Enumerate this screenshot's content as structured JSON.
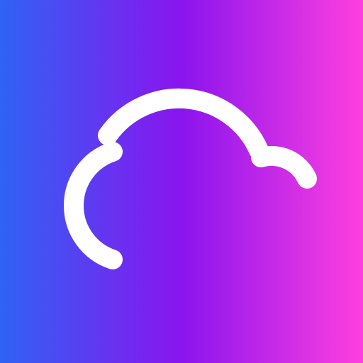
{
  "icon": {
    "name": "cloud-icon",
    "colors": {
      "gradient_start": "#2F63F4",
      "gradient_mid": "#8A14EE",
      "gradient_end": "#FF3FDF",
      "stroke": "#FFFFFF"
    }
  }
}
